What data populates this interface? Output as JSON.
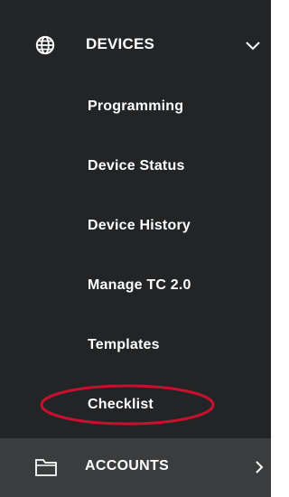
{
  "sidebar": {
    "devices": {
      "label": "DEVICES",
      "icon": "globe-icon",
      "expanded": true,
      "toggle_icon": "chevron-down-icon",
      "items": [
        {
          "label": "Programming"
        },
        {
          "label": "Device Status"
        },
        {
          "label": "Device History"
        },
        {
          "label": "Manage TC 2.0"
        },
        {
          "label": "Templates"
        },
        {
          "label": "Checklist",
          "highlighted": true
        }
      ]
    },
    "accounts": {
      "label": "ACCOUNTS",
      "icon": "folder-icon",
      "toggle_icon": "chevron-right-icon"
    }
  },
  "colors": {
    "panel_background": "#222426",
    "accounts_background": "#3a3c3e",
    "text": "#ffffff",
    "highlight_ellipse": "#c8102e"
  }
}
